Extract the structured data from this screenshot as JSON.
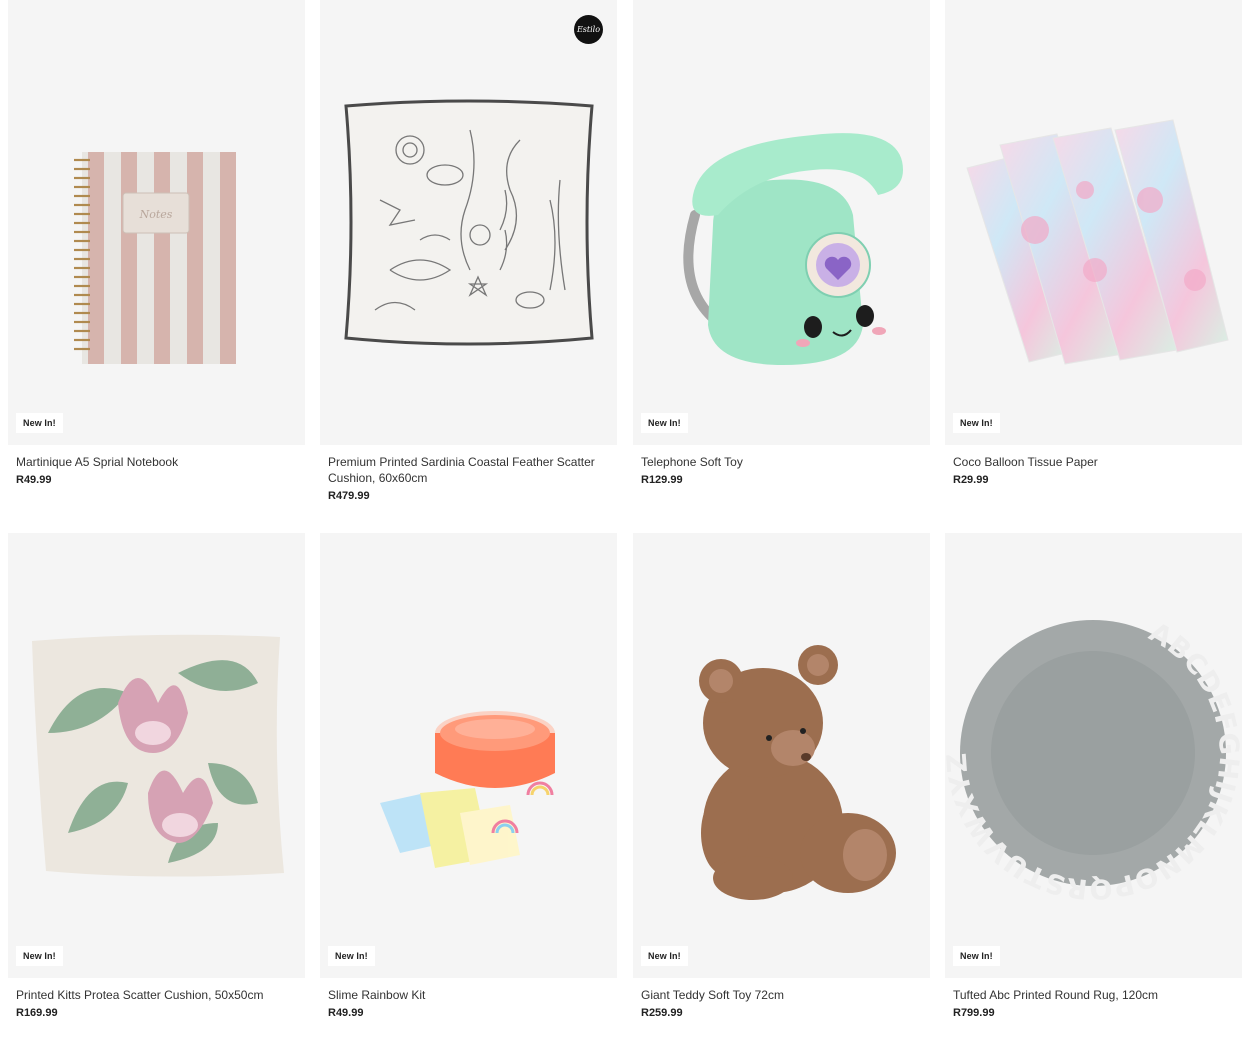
{
  "products": [
    {
      "title": "Martinique A5 Sprial Notebook",
      "price": "R49.99",
      "badge": "New In!",
      "icon": "striped-spiral-notebook"
    },
    {
      "title": "Premium Printed Sardinia Coastal Feather Scatter Cushion, 60x60cm",
      "price": "R479.99",
      "badge": "",
      "logo_text": "Estilo",
      "icon": "sea-print-cushion"
    },
    {
      "title": "Telephone Soft Toy",
      "price": "R129.99",
      "badge": "New In!",
      "icon": "mint-telephone-plush"
    },
    {
      "title": "Coco Balloon Tissue Paper",
      "price": "R29.99",
      "badge": "New In!",
      "icon": "pastel-tissue-paper"
    },
    {
      "title": "Printed Kitts Protea Scatter Cushion, 50x50cm",
      "price": "R169.99",
      "badge": "New In!",
      "icon": "protea-print-cushion"
    },
    {
      "title": "Slime Rainbow Kit",
      "price": "R49.99",
      "badge": "New In!",
      "icon": "slime-kit"
    },
    {
      "title": "Giant Teddy Soft Toy 72cm",
      "price": "R259.99",
      "badge": "New In!",
      "icon": "teddy-bear"
    },
    {
      "title": "Tufted Abc Printed Round Rug, 120cm",
      "price": "R799.99",
      "badge": "New In!",
      "rug_letters": "ABCDEFGHIJKLMNOPQRSTUVWXYZ",
      "icon": "alphabet-round-rug"
    }
  ],
  "colors": {
    "card_bg": "#f5f5f5",
    "badge_bg": "#ffffff",
    "text": "#333333"
  }
}
